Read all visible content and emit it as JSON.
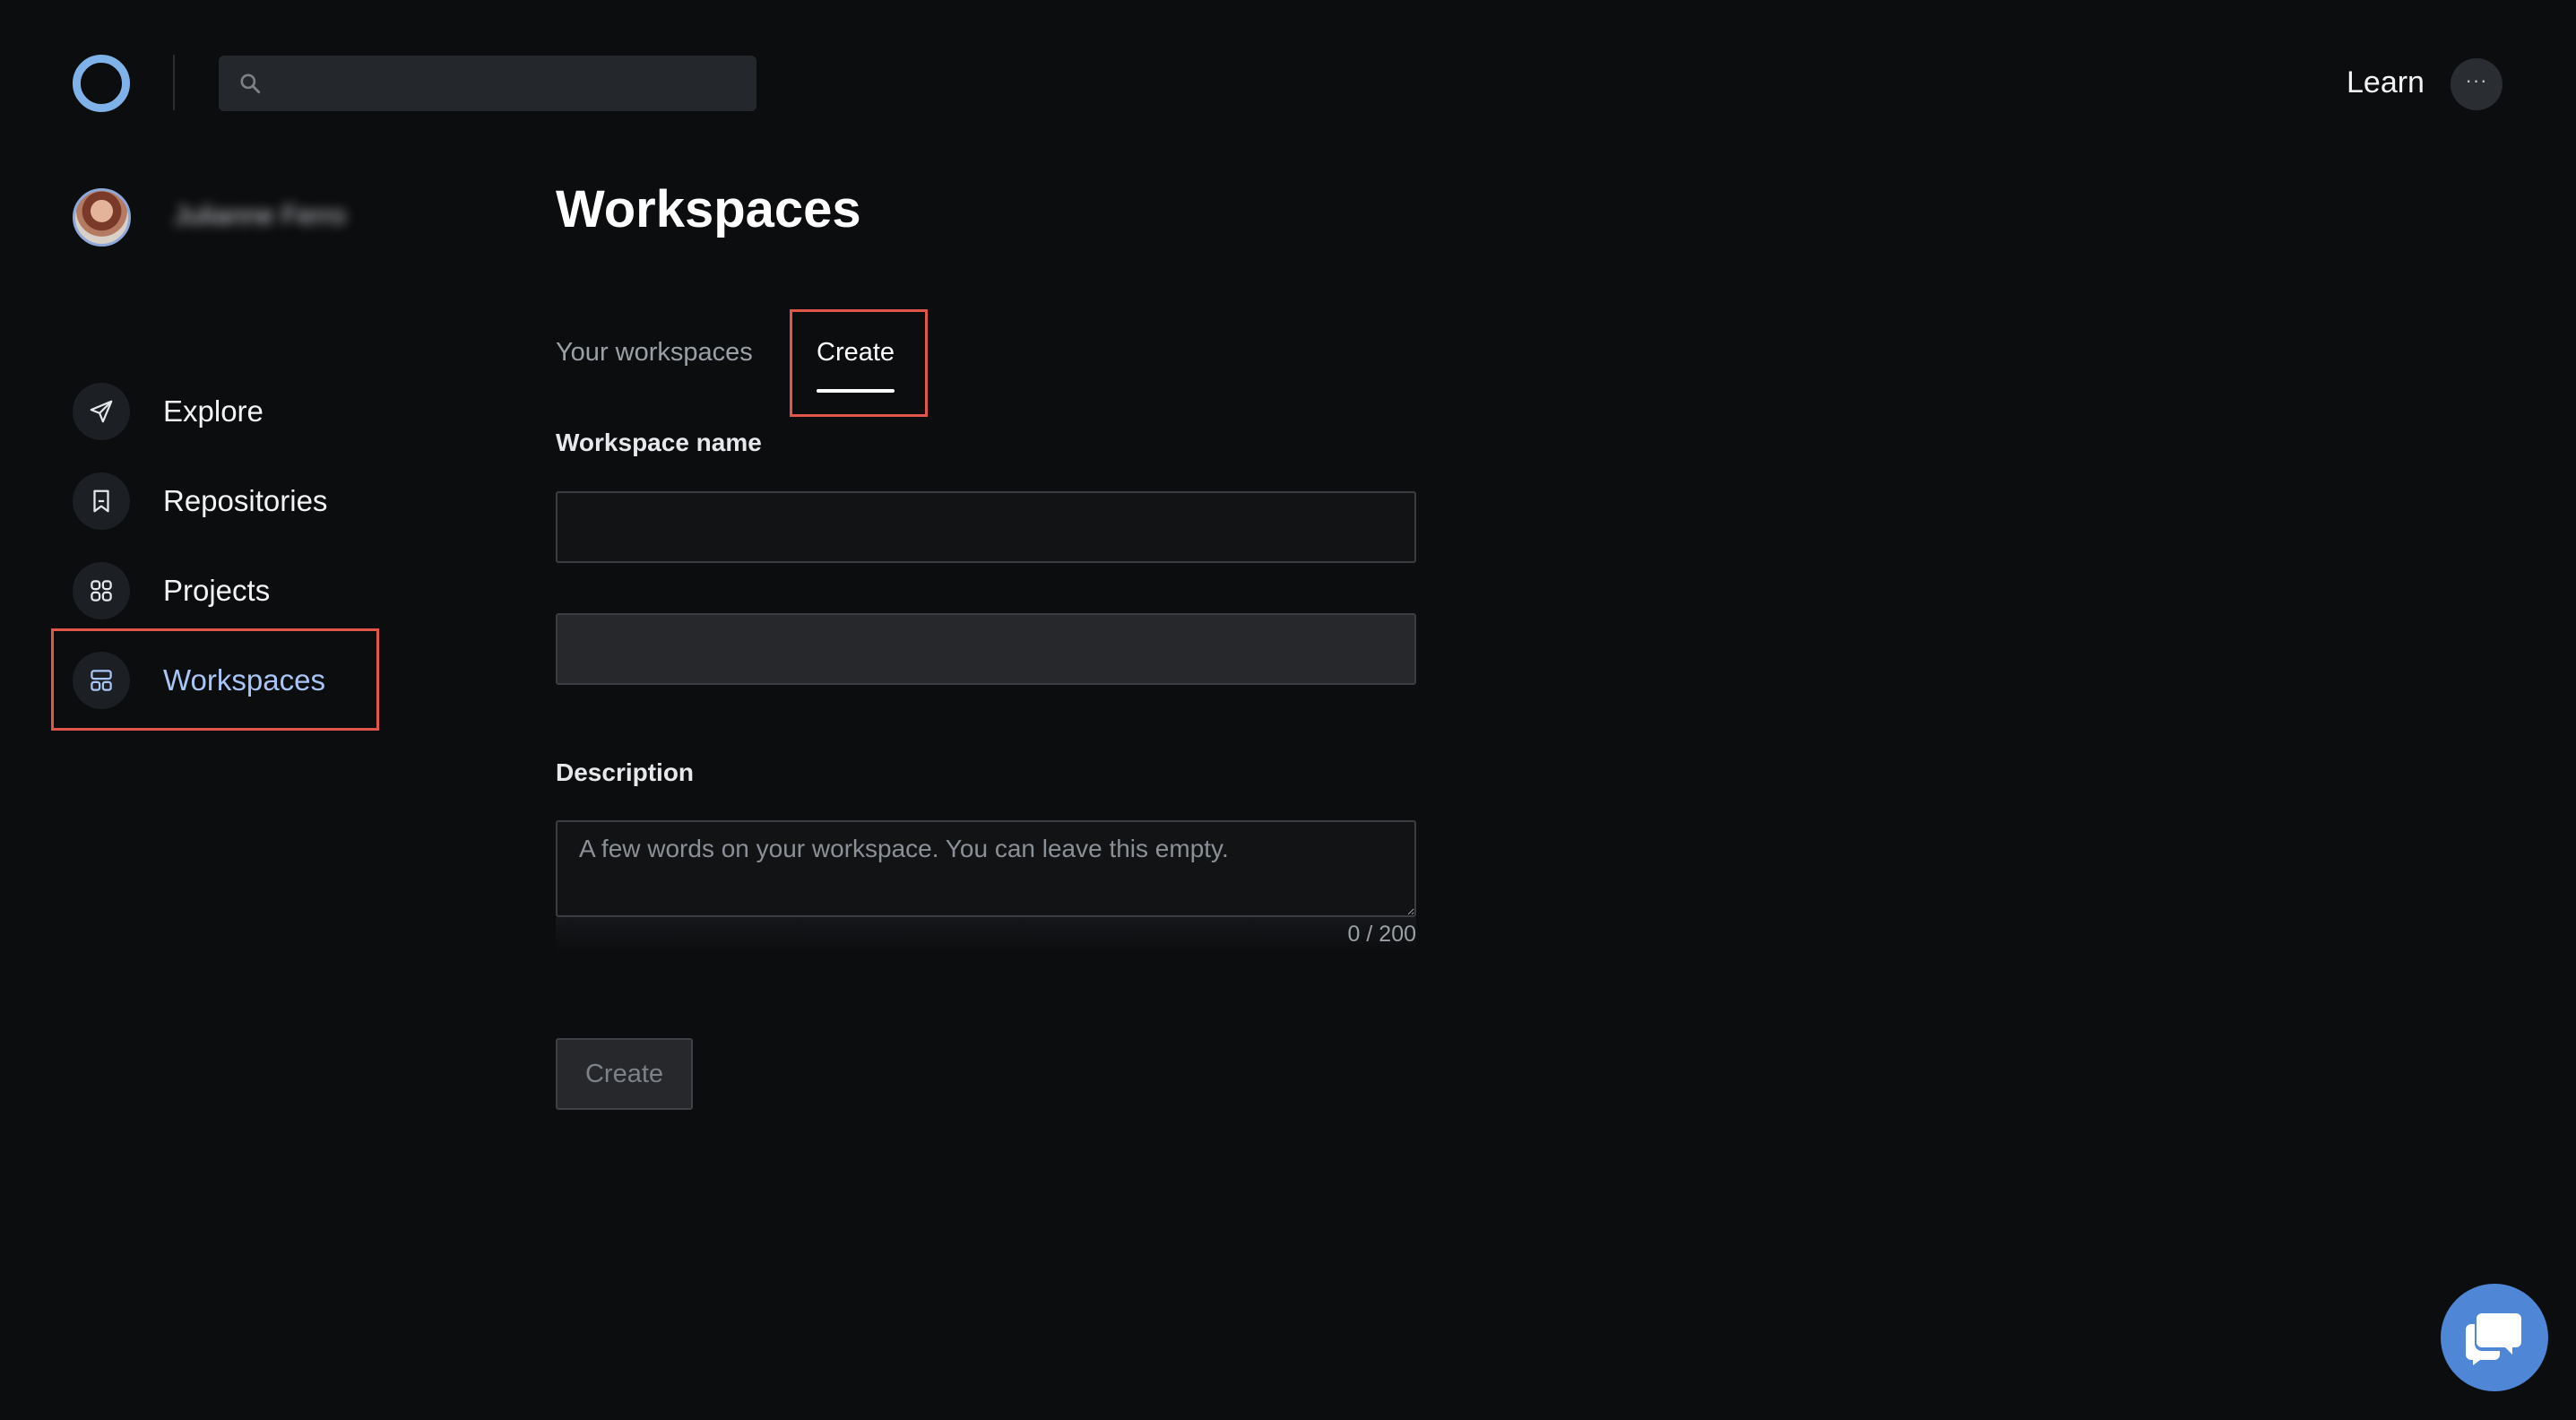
{
  "header": {
    "search_placeholder": "",
    "learn_label": "Learn",
    "more_label": "···"
  },
  "user": {
    "name": "Julianne Ferro"
  },
  "sidebar": {
    "items": [
      {
        "label": "Explore",
        "icon": "send-icon"
      },
      {
        "label": "Repositories",
        "icon": "bookmark-icon"
      },
      {
        "label": "Projects",
        "icon": "grid-icon"
      },
      {
        "label": "Workspaces",
        "icon": "layout-icon",
        "active": true
      }
    ]
  },
  "main": {
    "title": "Workspaces",
    "tabs": [
      {
        "label": "Your workspaces"
      },
      {
        "label": "Create",
        "active": true
      }
    ],
    "form": {
      "workspace_name_label": "Workspace name",
      "workspace_name_value": "",
      "secondary_value": "",
      "description_label": "Description",
      "description_placeholder": "A few words on your workspace. You can leave this empty.",
      "char_count": "0 / 200",
      "create_button": "Create"
    }
  },
  "colors": {
    "background": "#0c0d0f",
    "accent": "#a9c5f5",
    "highlight": "#e0564a",
    "chat": "#4f86d6"
  }
}
